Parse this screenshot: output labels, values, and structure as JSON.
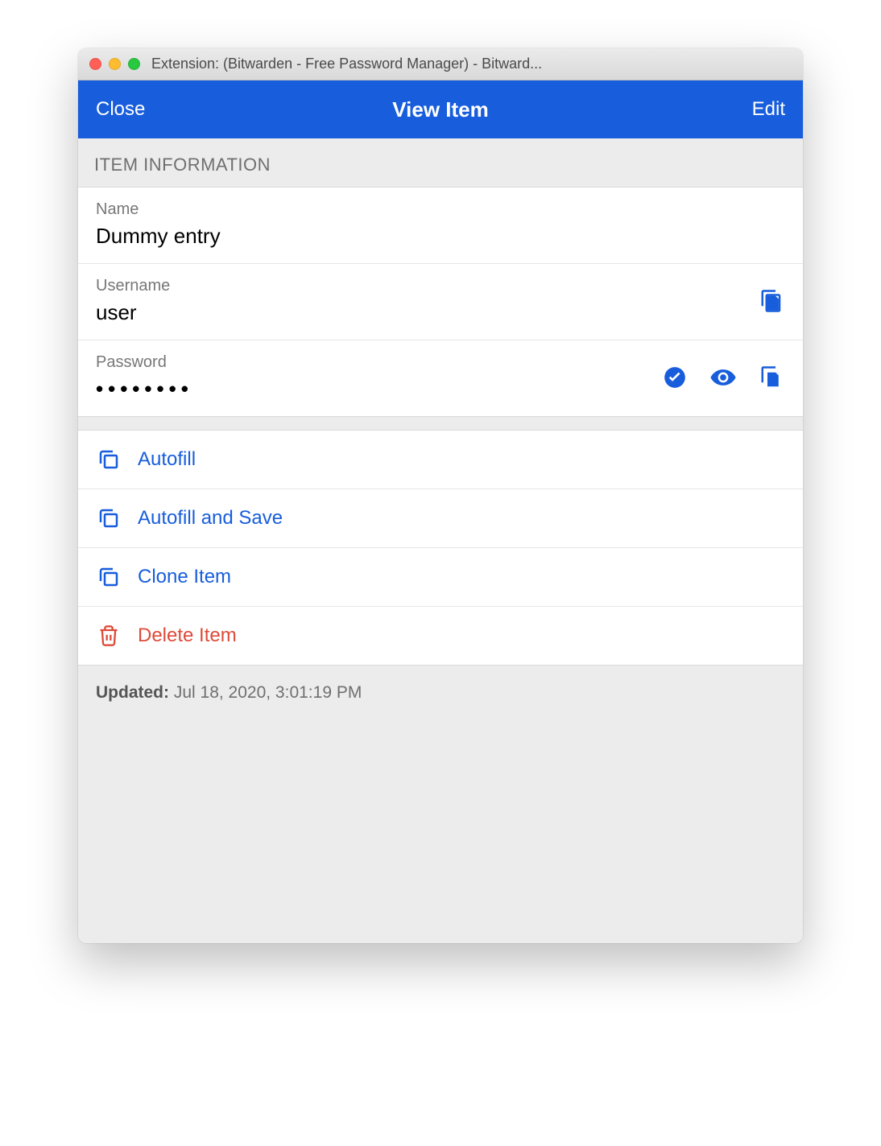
{
  "window": {
    "title": "Extension: (Bitwarden - Free Password Manager) - Bitward..."
  },
  "header": {
    "close": "Close",
    "title": "View Item",
    "edit": "Edit"
  },
  "section": {
    "item_info": "ITEM INFORMATION"
  },
  "fields": {
    "name_label": "Name",
    "name_value": "Dummy entry",
    "username_label": "Username",
    "username_value": "user",
    "password_label": "Password",
    "password_masked": "••••••••"
  },
  "actions": {
    "autofill": "Autofill",
    "autofill_save": "Autofill and Save",
    "clone": "Clone Item",
    "delete": "Delete Item"
  },
  "meta": {
    "updated_label": "Updated:",
    "updated_value": "Jul 18, 2020, 3:01:19 PM"
  }
}
